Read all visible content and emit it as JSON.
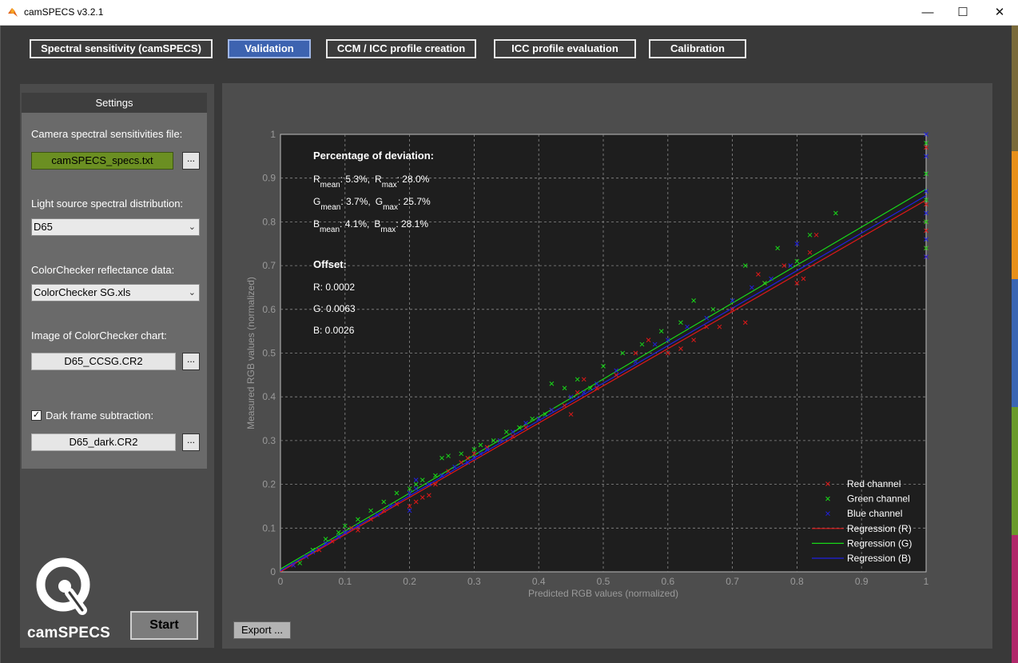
{
  "window": {
    "title": "camSPECS v3.2.1",
    "minimize": "—",
    "maximize": "☐",
    "close": "✕"
  },
  "tabs": [
    {
      "label": "Spectral sensitivity (camSPECS)",
      "active": false
    },
    {
      "label": "Validation",
      "active": true
    },
    {
      "label": "CCM / ICC profile creation",
      "active": false
    },
    {
      "label": "ICC profile evaluation",
      "active": false
    },
    {
      "label": "Calibration",
      "active": false
    }
  ],
  "settings": {
    "header": "Settings",
    "sens_label": "Camera spectral sensitivities file:",
    "sens_file": "camSPECS_specs.txt",
    "light_label": "Light source spectral distribution:",
    "light_value": "D65",
    "reflect_label": "ColorChecker reflectance data:",
    "reflect_value": "ColorChecker SG.xls",
    "image_label": "Image of ColorChecker chart:",
    "image_file": "D65_CCSG.CR2",
    "dark_label": "Dark frame subtraction:",
    "dark_checked": true,
    "dark_file": "D65_dark.CR2",
    "browse": "..."
  },
  "logo_text": "camSPECS",
  "start_button": "Start",
  "export_button": "Export ...",
  "colors": {
    "red": "#e01818",
    "green": "#18d818",
    "blue": "#2020e0",
    "active_tab": "#3d63b0",
    "file_green": "#6b8f22"
  },
  "chart_data": {
    "type": "scatter",
    "xlabel": "Predicted RGB values (normalized)",
    "ylabel": "Measured RGB values (normalized)",
    "xlim": [
      0,
      1
    ],
    "ylim": [
      0,
      1
    ],
    "grid": true,
    "legend_position": "bottom-right",
    "xticks": [
      "0",
      "0.1",
      "0.2",
      "0.3",
      "0.4",
      "0.5",
      "0.6",
      "0.7",
      "0.8",
      "0.9",
      "1"
    ],
    "yticks": [
      "0",
      "0.1",
      "0.2",
      "0.3",
      "0.4",
      "0.5",
      "0.6",
      "0.7",
      "0.8",
      "0.9",
      "1"
    ],
    "annotation": {
      "deviation_title": "Percentage of deviation:",
      "rows": [
        {
          "ch": "R",
          "mean": ": 5.3%,",
          "max": ": 28.0%"
        },
        {
          "ch": "G",
          "mean": ": 3.7%,",
          "max": ": 25.7%"
        },
        {
          "ch": "B",
          "mean": ": 4.1%,",
          "max": ": 28.1%"
        }
      ],
      "sub_mean": "mean",
      "sub_max": "max",
      "offset_title": "Offset:",
      "offsets": [
        "R: 0.0002",
        "G: 0.0063",
        "B: 0.0026"
      ]
    },
    "legend": [
      "Red channel",
      "Green channel",
      "Blue channel",
      "Regression (R)",
      "Regression (G)",
      "Regression (B)"
    ],
    "series": [
      {
        "name": "Red channel",
        "marker": "x",
        "color": "#e01818",
        "x": [
          0.02,
          0.04,
          0.06,
          0.08,
          0.1,
          0.11,
          0.12,
          0.14,
          0.16,
          0.18,
          0.2,
          0.21,
          0.22,
          0.23,
          0.24,
          0.26,
          0.28,
          0.29,
          0.3,
          0.32,
          0.34,
          0.36,
          0.38,
          0.4,
          0.42,
          0.44,
          0.45,
          0.46,
          0.47,
          0.49,
          0.52,
          0.55,
          0.57,
          0.6,
          0.62,
          0.64,
          0.66,
          0.68,
          0.7,
          0.72,
          0.74,
          0.75,
          0.78,
          0.8,
          0.81,
          0.82,
          0.83,
          1.0,
          1.0,
          1.0,
          1.0,
          1.0,
          1.0
        ],
        "y": [
          0.015,
          0.035,
          0.05,
          0.07,
          0.09,
          0.1,
          0.095,
          0.12,
          0.14,
          0.155,
          0.15,
          0.16,
          0.17,
          0.175,
          0.2,
          0.23,
          0.25,
          0.26,
          0.27,
          0.285,
          0.3,
          0.31,
          0.33,
          0.35,
          0.37,
          0.38,
          0.36,
          0.41,
          0.44,
          0.42,
          0.45,
          0.5,
          0.53,
          0.5,
          0.51,
          0.53,
          0.56,
          0.56,
          0.6,
          0.57,
          0.68,
          0.66,
          0.7,
          0.66,
          0.67,
          0.73,
          0.77,
          0.72,
          0.74,
          0.78,
          0.8,
          0.84,
          0.97
        ]
      },
      {
        "name": "Green channel",
        "marker": "x",
        "color": "#18d818",
        "x": [
          0.03,
          0.05,
          0.07,
          0.09,
          0.1,
          0.12,
          0.14,
          0.16,
          0.18,
          0.2,
          0.21,
          0.22,
          0.24,
          0.25,
          0.26,
          0.28,
          0.3,
          0.31,
          0.33,
          0.35,
          0.37,
          0.39,
          0.41,
          0.42,
          0.44,
          0.46,
          0.48,
          0.5,
          0.53,
          0.56,
          0.59,
          0.62,
          0.64,
          0.67,
          0.7,
          0.72,
          0.75,
          0.77,
          0.8,
          0.82,
          0.86,
          1.0,
          1.0,
          1.0,
          1.0,
          1.0
        ],
        "y": [
          0.02,
          0.05,
          0.075,
          0.09,
          0.105,
          0.12,
          0.14,
          0.16,
          0.18,
          0.19,
          0.2,
          0.21,
          0.22,
          0.26,
          0.265,
          0.27,
          0.28,
          0.29,
          0.3,
          0.32,
          0.33,
          0.35,
          0.36,
          0.43,
          0.42,
          0.44,
          0.42,
          0.47,
          0.5,
          0.52,
          0.55,
          0.57,
          0.62,
          0.6,
          0.62,
          0.7,
          0.66,
          0.74,
          0.71,
          0.77,
          0.82,
          0.74,
          0.8,
          0.85,
          0.91,
          0.98
        ]
      },
      {
        "name": "Blue channel",
        "marker": "x",
        "color": "#2020e0",
        "x": [
          0.02,
          0.04,
          0.05,
          0.07,
          0.09,
          0.1,
          0.12,
          0.15,
          0.17,
          0.2,
          0.2,
          0.21,
          0.21,
          0.23,
          0.25,
          0.27,
          0.29,
          0.3,
          0.31,
          0.32,
          0.34,
          0.36,
          0.38,
          0.4,
          0.42,
          0.45,
          0.47,
          0.49,
          0.52,
          0.55,
          0.58,
          0.6,
          0.63,
          0.66,
          0.7,
          0.73,
          0.76,
          0.79,
          0.8,
          1.0,
          1.0,
          1.0,
          1.0,
          1.0,
          1.0
        ],
        "y": [
          0.015,
          0.035,
          0.045,
          0.065,
          0.08,
          0.09,
          0.105,
          0.13,
          0.15,
          0.14,
          0.18,
          0.19,
          0.21,
          0.2,
          0.22,
          0.24,
          0.25,
          0.26,
          0.27,
          0.28,
          0.3,
          0.32,
          0.34,
          0.35,
          0.37,
          0.4,
          0.41,
          0.43,
          0.46,
          0.48,
          0.52,
          0.53,
          0.56,
          0.58,
          0.62,
          0.65,
          0.67,
          0.7,
          0.75,
          0.72,
          0.76,
          0.82,
          0.87,
          0.95,
          1.0
        ]
      }
    ],
    "regression": [
      {
        "name": "Regression (R)",
        "color": "#e01818",
        "x": [
          0,
          1
        ],
        "y": [
          0.0002,
          0.85
        ]
      },
      {
        "name": "Regression (G)",
        "color": "#18d818",
        "x": [
          0,
          1
        ],
        "y": [
          0.0063,
          0.875
        ]
      },
      {
        "name": "Regression (B)",
        "color": "#2020e0",
        "x": [
          0,
          1
        ],
        "y": [
          0.0026,
          0.86
        ]
      }
    ]
  }
}
